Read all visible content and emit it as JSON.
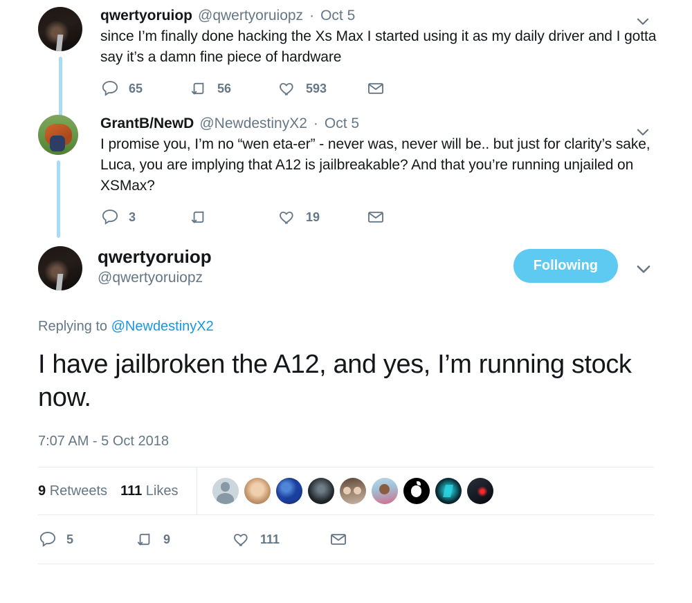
{
  "thread": {
    "ancestors": [
      {
        "name": "qwertyoruiop",
        "handle": "@qwertyoruiopz",
        "separator": "·",
        "time": "Oct 5",
        "text": "since I’m finally done hacking the Xs Max I started using it as my daily driver and I gotta say it’s a damn fine piece of hardware",
        "avatar_style": "art-dark",
        "actions": {
          "reply_count": "65",
          "retweet_count": "56",
          "like_count": "593",
          "dm_label": ""
        }
      },
      {
        "name": "GrantB/NewD",
        "handle": "@NewdestinyX2",
        "separator": "·",
        "time": "Oct 5",
        "text": "I promise you, I’m no “wen eta-er” - never was, never will be.. but just for clarity’s sake, Luca, you are implying that A12 is jailbreakable? And that you’re running unjailed on XSMax?",
        "avatar_style": "art-outdoor",
        "actions": {
          "reply_count": "3",
          "retweet_count": "",
          "like_count": "19",
          "dm_label": ""
        }
      }
    ],
    "main": {
      "name": "qwertyoruiop",
      "handle": "@qwertyoruiopz",
      "avatar_style": "art-dark",
      "follow_button": "Following",
      "replying_prefix": "Replying to",
      "replying_mention": "@NewdestinyX2",
      "text": "I have jailbroken the A12, and yes, I’m running stock now.",
      "timestamp": "7:07 AM - 5 Oct 2018",
      "stats": {
        "retweets_count": "9",
        "retweets_label": "Retweets",
        "likes_count": "111",
        "likes_label": "Likes",
        "facepile": [
          "art-person-default",
          "art-blonde",
          "art-blue-swirl",
          "art-skull",
          "art-couple",
          "art-selfie",
          "art-apple",
          "art-teal",
          "art-red"
        ]
      },
      "actions": {
        "reply_count": "5",
        "retweet_count": "9",
        "like_count": "111",
        "dm_label": ""
      }
    }
  },
  "colors": {
    "accent": "#1b95e0",
    "follow_button": "#5ecaf2",
    "thread_line": "#a9dcf0",
    "muted_text": "#657786",
    "primary_text": "#14171a",
    "divider": "#e6ecf0"
  },
  "icons": {
    "reply": "reply-icon",
    "retweet": "retweet-icon",
    "like": "heart-icon",
    "dm": "envelope-icon",
    "caret": "chevron-down-icon"
  }
}
